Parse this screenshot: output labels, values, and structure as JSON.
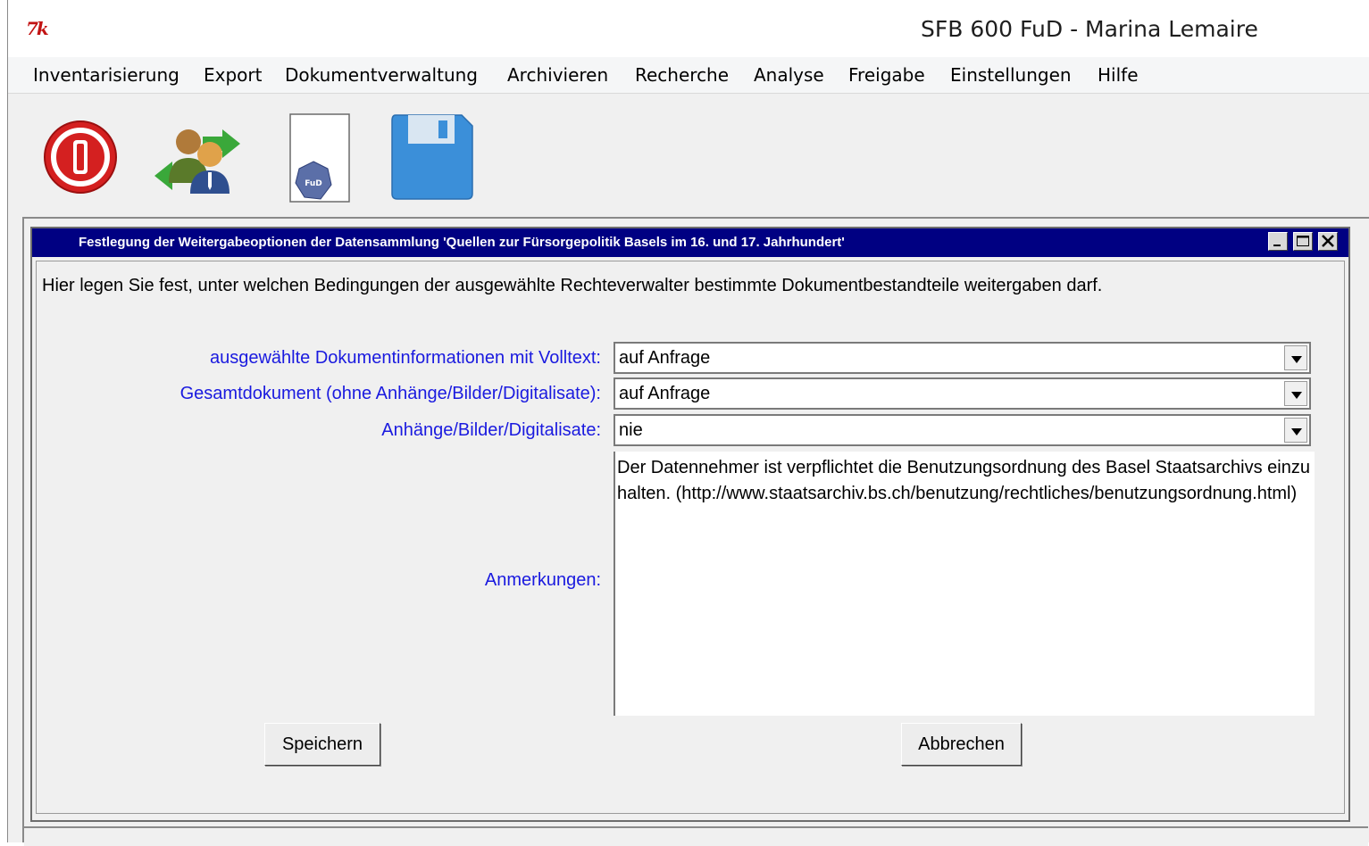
{
  "app": {
    "logo_text": "7k",
    "title": "SFB 600 FuD - Marina Lemaire"
  },
  "menu": [
    {
      "label": "Inventarisierung"
    },
    {
      "label": "Export"
    },
    {
      "label": "Dokumentverwaltung"
    },
    {
      "label": "Archivieren"
    },
    {
      "label": "Recherche"
    },
    {
      "label": "Analyse"
    },
    {
      "label": "Freigabe"
    },
    {
      "label": "Einstellungen"
    },
    {
      "label": "Hilfe"
    }
  ],
  "toolbar": {
    "icons": [
      "power-icon",
      "users-exchange-icon",
      "fud-document-icon",
      "floppy-save-icon"
    ],
    "doc_badge": "FuD"
  },
  "dialog": {
    "title": "Festlegung der Weitergabeoptionen der Datensammlung 'Quellen zur Fürsorgepolitik Basels im 16. und 17. Jahrhundert'",
    "intro": "Hier legen Sie fest, unter welchen Bedingungen der ausgewählte Rechteverwalter bestimmte Dokumentbestandteile weitergaben darf.",
    "fields": [
      {
        "label": "ausgewählte Dokumentinformationen mit Volltext:",
        "value": "auf Anfrage"
      },
      {
        "label": "Gesamtdokument (ohne Anhänge/Bilder/Digitalisate):",
        "value": "auf Anfrage"
      },
      {
        "label": "Anhänge/Bilder/Digitalisate:",
        "value": "nie"
      }
    ],
    "notes": {
      "label": "Anmerkungen:",
      "value": "Der Datennehmer ist verpflichtet die Benutzungsordnung des Basel Staatsarchivs einzuhalten. (http://www.staatsarchiv.bs.ch/benutzung/rechtliches/benutzungsordnung.html)"
    },
    "save_label": "Speichern",
    "cancel_label": "Abbrechen"
  },
  "colors": {
    "dialog_titlebar": "#000082",
    "label_text": "#1a1adf",
    "logo_red": "#c21313"
  }
}
